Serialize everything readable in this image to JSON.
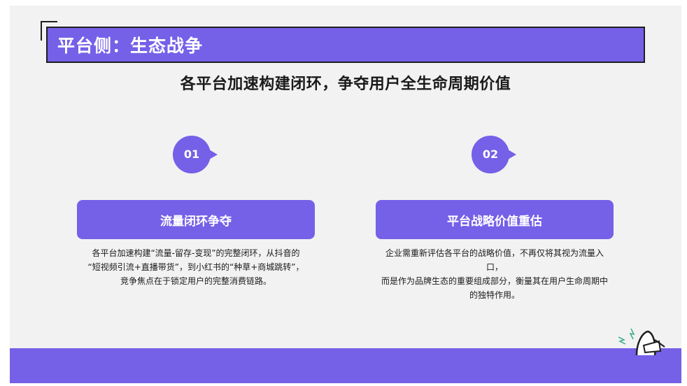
{
  "slide": {
    "title": "平台侧：生态战争",
    "subtitle": "各平台加速构建闭环，争夺用户全生命周期价值",
    "cards": [
      {
        "number": "01",
        "heading": "流量闭环争夺",
        "lines": [
          "各平台加速构建“流量-留存-变现”的完整闭环，从抖音的",
          "“短视频引流+直播带货”，到小红书的“种草+商城跳转”，",
          "竞争焦点在于锁定用户的完整消费链路。"
        ]
      },
      {
        "number": "02",
        "heading": "平台战略价值重估",
        "lines": [
          "企业需重新评估各平台的战略价值，不再仅将其视为流量入口，",
          "而是作为品牌生态的重要组成部分，衡量其在用户生命周期中",
          "的独特作用。"
        ]
      }
    ]
  },
  "colors": {
    "accent": "#7560e8",
    "background": "#f2f2f2",
    "text": "#1a1a1a"
  },
  "icons": [
    "megaphone-icon",
    "sparkle-icon"
  ]
}
